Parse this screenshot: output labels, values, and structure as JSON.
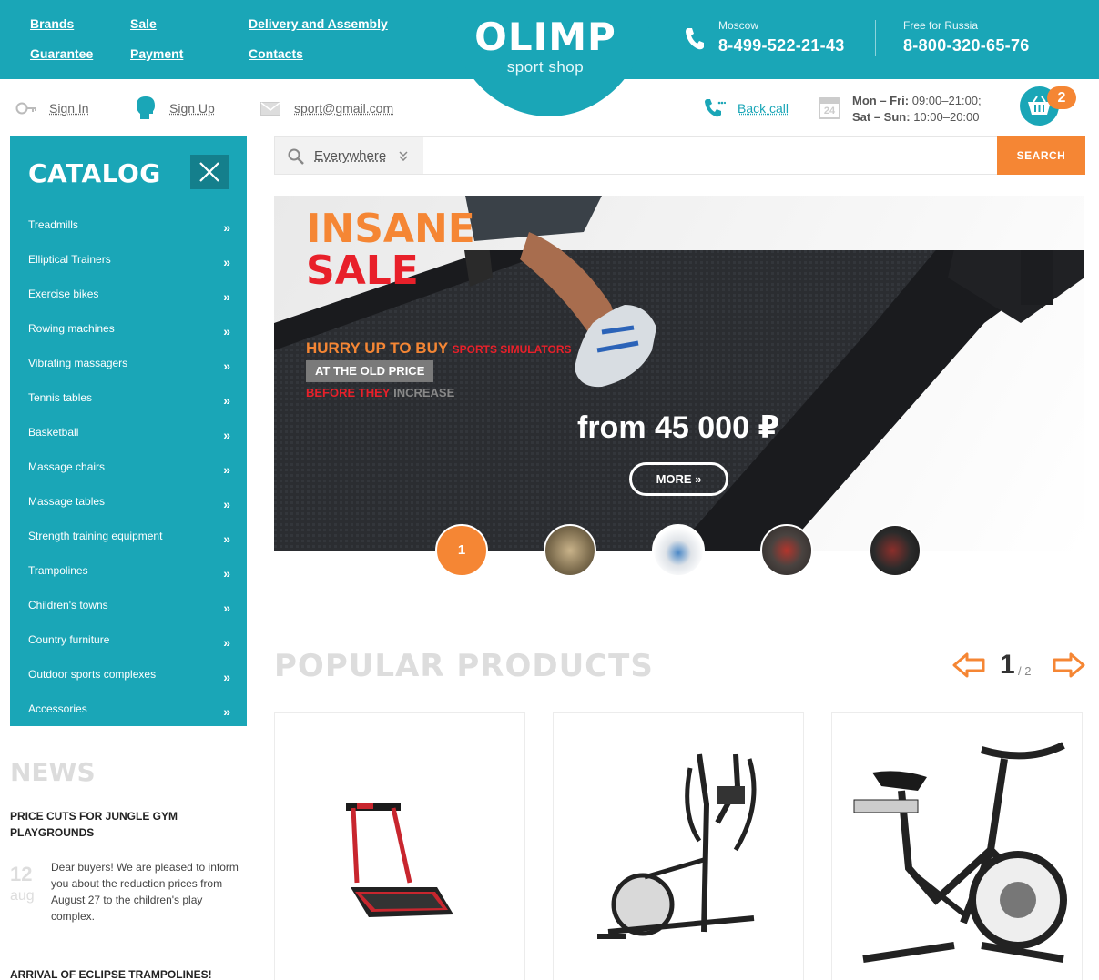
{
  "header": {
    "nav": [
      "Brands",
      "Sale",
      "Delivery and Assembly",
      "Guarantee",
      "Payment",
      "Contacts"
    ],
    "logo_title": "OLIMP",
    "logo_subtitle": "sport shop",
    "phone1": {
      "city": "Moscow",
      "number": "8-499-522-21-43"
    },
    "phone2": {
      "city": "Free for Russia",
      "number": "8-800-320-65-76"
    }
  },
  "subheader": {
    "sign_in": "Sign In",
    "sign_up": "Sign Up",
    "email": "sport@gmail.com",
    "back_call": "Back call",
    "hours_weekday_label": "Mon – Fri:",
    "hours_weekday": "09:00–21:00;",
    "hours_weekend_label": "Sat – Sun:",
    "hours_weekend": "10:00–20:00",
    "calendar_day": "24",
    "cart_count": "2"
  },
  "catalog": {
    "title": "CATALOG",
    "items": [
      "Treadmills",
      "Elliptical Trainers",
      "Exercise bikes",
      "Rowing machines",
      "Vibrating massagers",
      "Tennis tables",
      "Basketball",
      "Massage chairs",
      "Massage tables",
      "Strength training equipment",
      "Trampolines",
      "Children's towns",
      "Country furniture",
      "Outdoor sports complexes",
      "Accessories"
    ]
  },
  "news": {
    "title": "NEWS",
    "headline": "PRICE CUTS FOR JUNGLE GYM PLAYGROUNDS",
    "day": "12",
    "month": "aug",
    "text": "Dear buyers! We are pleased to inform you about the reduction prices from August 27 to the children's play complex.",
    "headline2": "ARRIVAL OF ECLIPSE TRAMPOLINES!"
  },
  "search": {
    "scope": "Everywhere",
    "button": "SEARCH"
  },
  "banner": {
    "line1": "INSANE",
    "line2": "SALE",
    "hurry": "HURRY UP TO BUY",
    "hurry_small": "SPORTS SIMULATORS",
    "old_price": "AT THE OLD PRICE",
    "before": "BEFORE THEY",
    "increase": "INCREASE",
    "price": "from 45 000 ₽",
    "more": "MORE",
    "active_slide": "1"
  },
  "popular": {
    "title": "POPULAR PRODUCTS",
    "page": "1",
    "total": "/ 2"
  },
  "colors": {
    "brand": "#1aa6b7",
    "accent": "#f58634",
    "red": "#e8202a"
  }
}
